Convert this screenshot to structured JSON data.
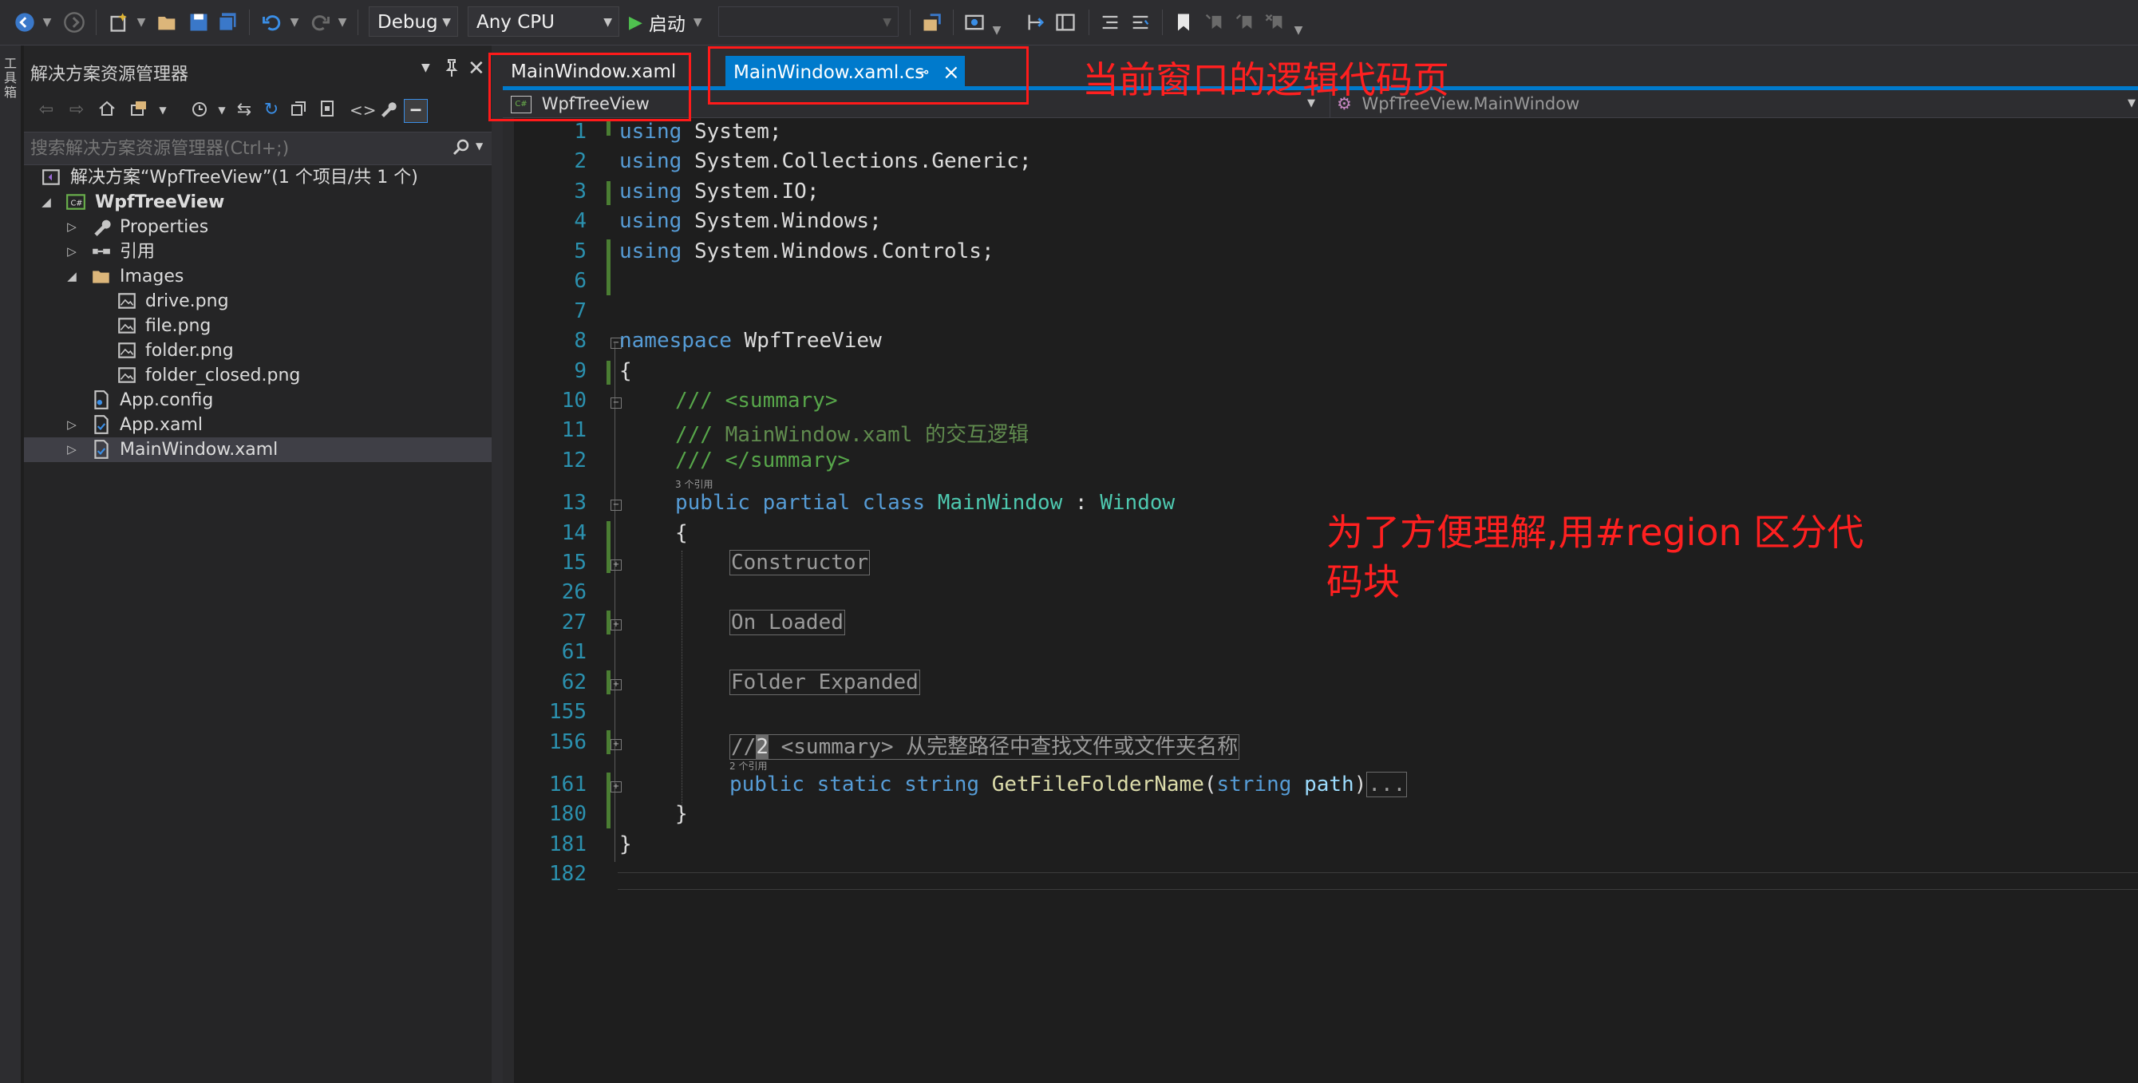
{
  "toolbar": {
    "config": "Debug",
    "platform": "Any CPU",
    "start_label": "启动",
    "start_target": ""
  },
  "side_strip": {
    "label": "工具箱"
  },
  "solution_explorer": {
    "title": "解决方案资源管理器",
    "search_placeholder": "搜索解决方案资源管理器(Ctrl+;)",
    "solution_label": "解决方案“WpfTreeView”(1 个项目/共 1 个)",
    "project_label": "WpfTreeView",
    "items": [
      {
        "label": "Properties"
      },
      {
        "label": "引用"
      },
      {
        "label": "Images"
      },
      {
        "label": "drive.png"
      },
      {
        "label": "file.png"
      },
      {
        "label": "folder.png"
      },
      {
        "label": "folder_closed.png"
      },
      {
        "label": "App.config"
      },
      {
        "label": "App.xaml"
      },
      {
        "label": "MainWindow.xaml"
      }
    ]
  },
  "tabs": {
    "xaml": "MainWindow.xaml",
    "cs": "MainWindow.xaml.cs"
  },
  "navbar": {
    "project": "WpfTreeView",
    "class": "WpfTreeView.MainWindow"
  },
  "editor": {
    "line_numbers": [
      "1",
      "2",
      "3",
      "4",
      "5",
      "6",
      "7",
      "8",
      "9",
      "10",
      "11",
      "12",
      "13",
      "14",
      "15",
      "26",
      "27",
      "61",
      "62",
      "155",
      "156",
      "161",
      "180",
      "181",
      "182"
    ],
    "using_kw": "using",
    "using_ns": [
      "System;",
      "System.Collections.Generic;",
      "System.IO;",
      "System.Windows;",
      "System.Windows.Controls;"
    ],
    "namespace_kw": "namespace",
    "namespace_name": "WpfTreeView",
    "open_brace": "{",
    "close_brace": "}",
    "doc_summary_open": "/// <summary>",
    "doc_prefix": "/// ",
    "doc_text": "MainWindow.xaml 的交互逻辑",
    "doc_summary_close": "/// </summary>",
    "refs_class": "3 个引用",
    "class_kw": "public partial class",
    "class_name": "MainWindow",
    "class_colon": " : ",
    "class_base": "Window",
    "regions": [
      "Constructor",
      "On Loaded",
      "Folder Expanded"
    ],
    "summary_prefix": "//",
    "summary_badge": "2",
    "summary_text": " <summary> 从完整路径中查找文件或文件夹名称",
    "refs_method": "2 个引用",
    "method_kw": "public static string",
    "method_name": "GetFileFolderName",
    "method_paren_open": "(",
    "param_type": "string",
    "param_name": "path",
    "method_paren_close": ")",
    "method_ellipsis": "..."
  },
  "annotations": {
    "tab_note": "当前窗口的逻辑代码页",
    "region_note_1": "为了方便理解,用#region 区分代",
    "region_note_2": "码块"
  }
}
